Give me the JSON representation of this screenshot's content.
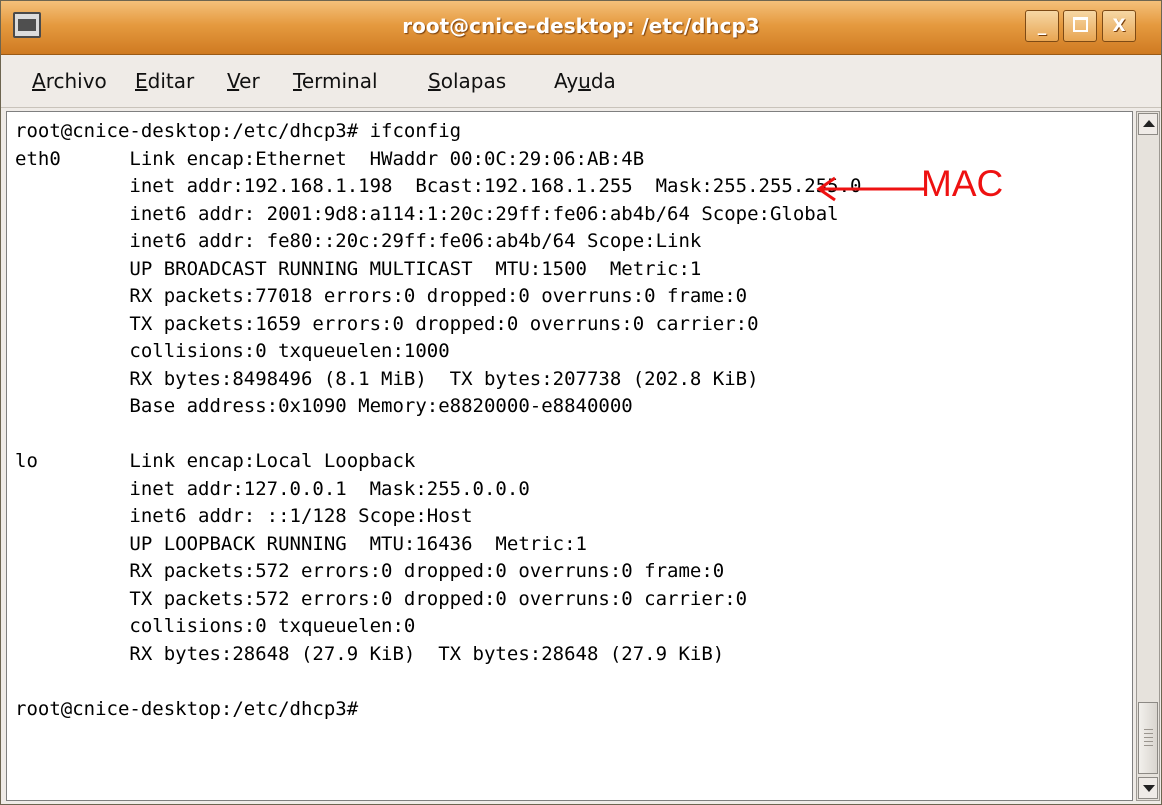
{
  "window": {
    "title": "root@cnice-desktop: /etc/dhcp3",
    "buttons": {
      "minimize": "_",
      "close": "X"
    }
  },
  "menu": [
    {
      "mnemonic": "A",
      "rest": "rchivo"
    },
    {
      "mnemonic": "E",
      "rest": "ditar"
    },
    {
      "mnemonic": "V",
      "rest": "er"
    },
    {
      "mnemonic": "T",
      "rest": "erminal"
    },
    {
      "mnemonic": "S",
      "rest": "olapas"
    },
    {
      "pre": "Ay",
      "mnemonic": "u",
      "rest": "da"
    }
  ],
  "terminal": {
    "lines": [
      "root@cnice-desktop:/etc/dhcp3# ifconfig",
      "eth0      Link encap:Ethernet  HWaddr 00:0C:29:06:AB:4B",
      "          inet addr:192.168.1.198  Bcast:192.168.1.255  Mask:255.255.255.0",
      "          inet6 addr: 2001:9d8:a114:1:20c:29ff:fe06:ab4b/64 Scope:Global",
      "          inet6 addr: fe80::20c:29ff:fe06:ab4b/64 Scope:Link",
      "          UP BROADCAST RUNNING MULTICAST  MTU:1500  Metric:1",
      "          RX packets:77018 errors:0 dropped:0 overruns:0 frame:0",
      "          TX packets:1659 errors:0 dropped:0 overruns:0 carrier:0",
      "          collisions:0 txqueuelen:1000",
      "          RX bytes:8498496 (8.1 MiB)  TX bytes:207738 (202.8 KiB)",
      "          Base address:0x1090 Memory:e8820000-e8840000",
      "",
      "lo        Link encap:Local Loopback",
      "          inet addr:127.0.0.1  Mask:255.0.0.0",
      "          inet6 addr: ::1/128 Scope:Host",
      "          UP LOOPBACK RUNNING  MTU:16436  Metric:1",
      "          RX packets:572 errors:0 dropped:0 overruns:0 frame:0",
      "          TX packets:572 errors:0 dropped:0 overruns:0 carrier:0",
      "          collisions:0 txqueuelen:0",
      "          RX bytes:28648 (27.9 KiB)  TX bytes:28648 (27.9 KiB)",
      "",
      "root@cnice-desktop:/etc/dhcp3#"
    ]
  },
  "annotation": {
    "label": "MAC",
    "color": "#ee1111"
  }
}
